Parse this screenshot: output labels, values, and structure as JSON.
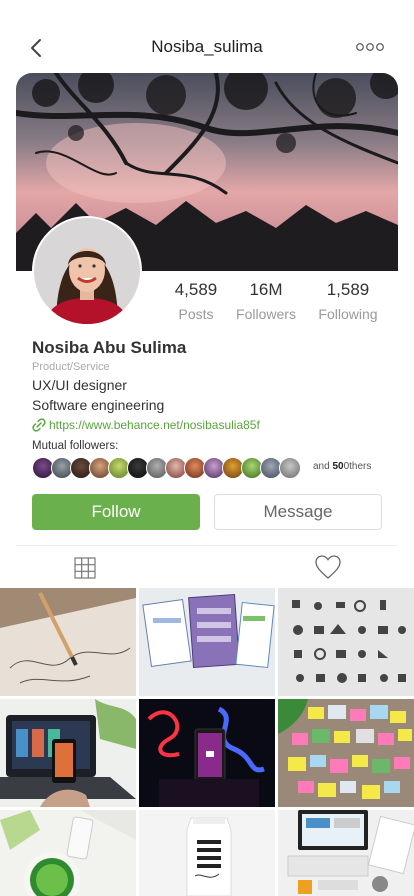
{
  "header": {
    "username": "Nosiba_sulima",
    "back_icon": "chevron-left-icon",
    "more_icon": "more-dots-icon"
  },
  "profile": {
    "display_name": "Nosiba Abu Sulima",
    "category": "Product/Service",
    "bio_line1": "UX/UI designer",
    "bio_line2": "Software engineering",
    "website": "https://www.behance.net/nosibasulia85f"
  },
  "stats": {
    "posts": {
      "value": "4,589",
      "label": "Posts"
    },
    "followers": {
      "value": "16M",
      "label": "Followers"
    },
    "following": {
      "value": "1,589",
      "label": "Following"
    }
  },
  "mutual": {
    "label": "Mutual followers:",
    "prefix": "and",
    "count": "50",
    "suffix": "0thers"
  },
  "actions": {
    "follow": "Follow",
    "message": "Message"
  },
  "tabs": {
    "grid_icon": "grid-icon",
    "liked_icon": "heart-icon"
  },
  "colors": {
    "accent": "#6ab04c",
    "link": "#5aa33f"
  }
}
